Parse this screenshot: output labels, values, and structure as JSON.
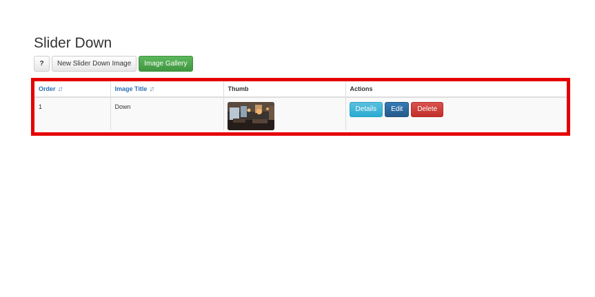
{
  "page": {
    "title": "Slider Down"
  },
  "toolbar": {
    "help_label": "?",
    "new_label": "New Slider Down Image",
    "gallery_label": "Image Gallery"
  },
  "table": {
    "columns": [
      {
        "label": "Order",
        "sortable": true
      },
      {
        "label": "Image Title",
        "sortable": true
      },
      {
        "label": "Thumb",
        "sortable": false
      },
      {
        "label": "Actions",
        "sortable": false
      }
    ],
    "sort_icon": "↓↑",
    "rows": [
      {
        "order": "1",
        "image_title": "Down",
        "thumb_icon": "restaurant-interior-thumbnail",
        "actions": {
          "details": "Details",
          "edit": "Edit",
          "delete": "Delete"
        }
      }
    ]
  },
  "colors": {
    "highlight": "#e60000",
    "link": "#2a6fb5",
    "success": "#5cb85c",
    "info": "#5bc0de",
    "primary": "#337ab7",
    "danger": "#d9534f"
  }
}
